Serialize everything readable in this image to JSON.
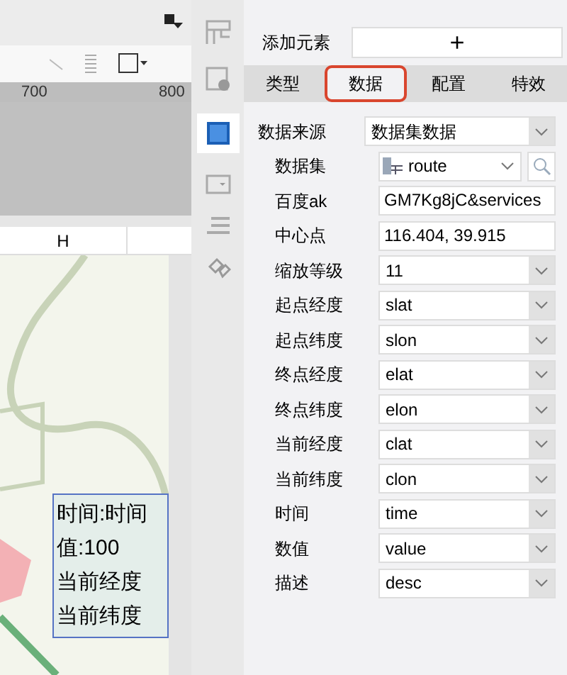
{
  "canvas": {
    "ruler_ticks": [
      "700",
      "800"
    ],
    "column_header": "H",
    "tooltip_lines": [
      "时间:时间",
      "值:100",
      "当前经度",
      "当前纬度"
    ]
  },
  "panel": {
    "add_element": {
      "label": "添加元素",
      "button": "+"
    },
    "tabs": [
      {
        "label": "类型",
        "selected": false
      },
      {
        "label": "数据",
        "selected": true
      },
      {
        "label": "配置",
        "selected": false
      },
      {
        "label": "特效",
        "selected": false
      }
    ],
    "fields": [
      {
        "kind": "select",
        "label": "数据来源",
        "value": "数据集数据"
      },
      {
        "kind": "dataset",
        "label": "数据集",
        "value": "route"
      },
      {
        "kind": "text",
        "label": "百度ak",
        "value": "GM7Kg8jC&services"
      },
      {
        "kind": "text",
        "label": "中心点",
        "value": "116.404, 39.915"
      },
      {
        "kind": "select",
        "label": "缩放等级",
        "value": "11"
      },
      {
        "kind": "select",
        "label": "起点经度",
        "value": "slat"
      },
      {
        "kind": "select",
        "label": "起点纬度",
        "value": "slon"
      },
      {
        "kind": "select",
        "label": "终点经度",
        "value": "elat"
      },
      {
        "kind": "select",
        "label": "终点纬度",
        "value": "elon"
      },
      {
        "kind": "select",
        "label": "当前经度",
        "value": "clat"
      },
      {
        "kind": "select",
        "label": "当前纬度",
        "value": "clon"
      },
      {
        "kind": "select",
        "label": "时间",
        "value": "time"
      },
      {
        "kind": "select",
        "label": "数值",
        "value": "value"
      },
      {
        "kind": "select",
        "label": "描述",
        "value": "desc"
      }
    ]
  }
}
